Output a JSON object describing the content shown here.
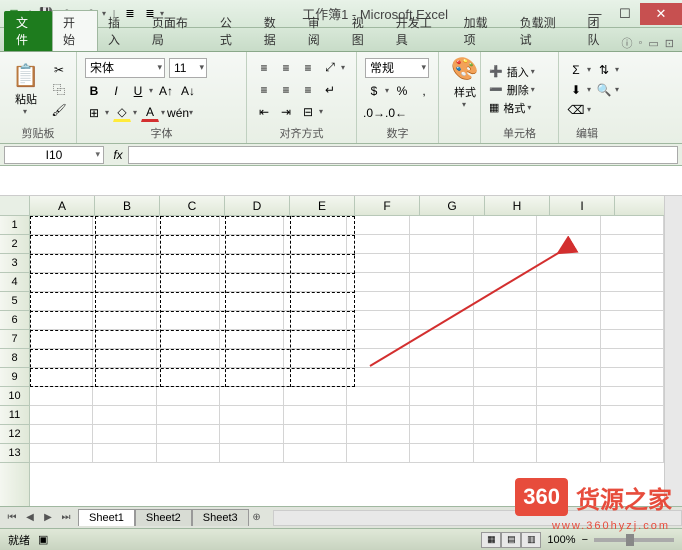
{
  "titlebar": {
    "title": "工作簿1 - Microsoft Excel"
  },
  "tabs": {
    "file": "文件",
    "items": [
      "开始",
      "插入",
      "页面布局",
      "公式",
      "数据",
      "审阅",
      "视图",
      "开发工具",
      "加载项",
      "负载测试",
      "团队"
    ]
  },
  "ribbon": {
    "clipboard": {
      "paste": "粘贴",
      "label": "剪贴板"
    },
    "font": {
      "name": "宋体",
      "size": "11",
      "label": "字体"
    },
    "alignment": {
      "label": "对齐方式"
    },
    "number": {
      "format": "常规",
      "label": "数字"
    },
    "styles": {
      "btn": "样式"
    },
    "cells": {
      "insert": "插入",
      "delete": "删除",
      "format": "格式",
      "label": "单元格"
    },
    "editing": {
      "label": "编辑"
    }
  },
  "formula": {
    "namebox": "I10",
    "fx": "fx"
  },
  "columns": [
    "A",
    "B",
    "C",
    "D",
    "E",
    "F",
    "G",
    "H",
    "I"
  ],
  "rows": [
    "1",
    "2",
    "3",
    "4",
    "5",
    "6",
    "7",
    "8",
    "9",
    "10",
    "11",
    "12",
    "13"
  ],
  "sheets": {
    "active": "Sheet1",
    "tabs": [
      "Sheet1",
      "Sheet2",
      "Sheet3"
    ]
  },
  "status": {
    "ready": "就绪",
    "zoom": "100%"
  },
  "watermark": {
    "badge": "360",
    "text": "货源之家",
    "url": "www.360hyzj.com"
  }
}
